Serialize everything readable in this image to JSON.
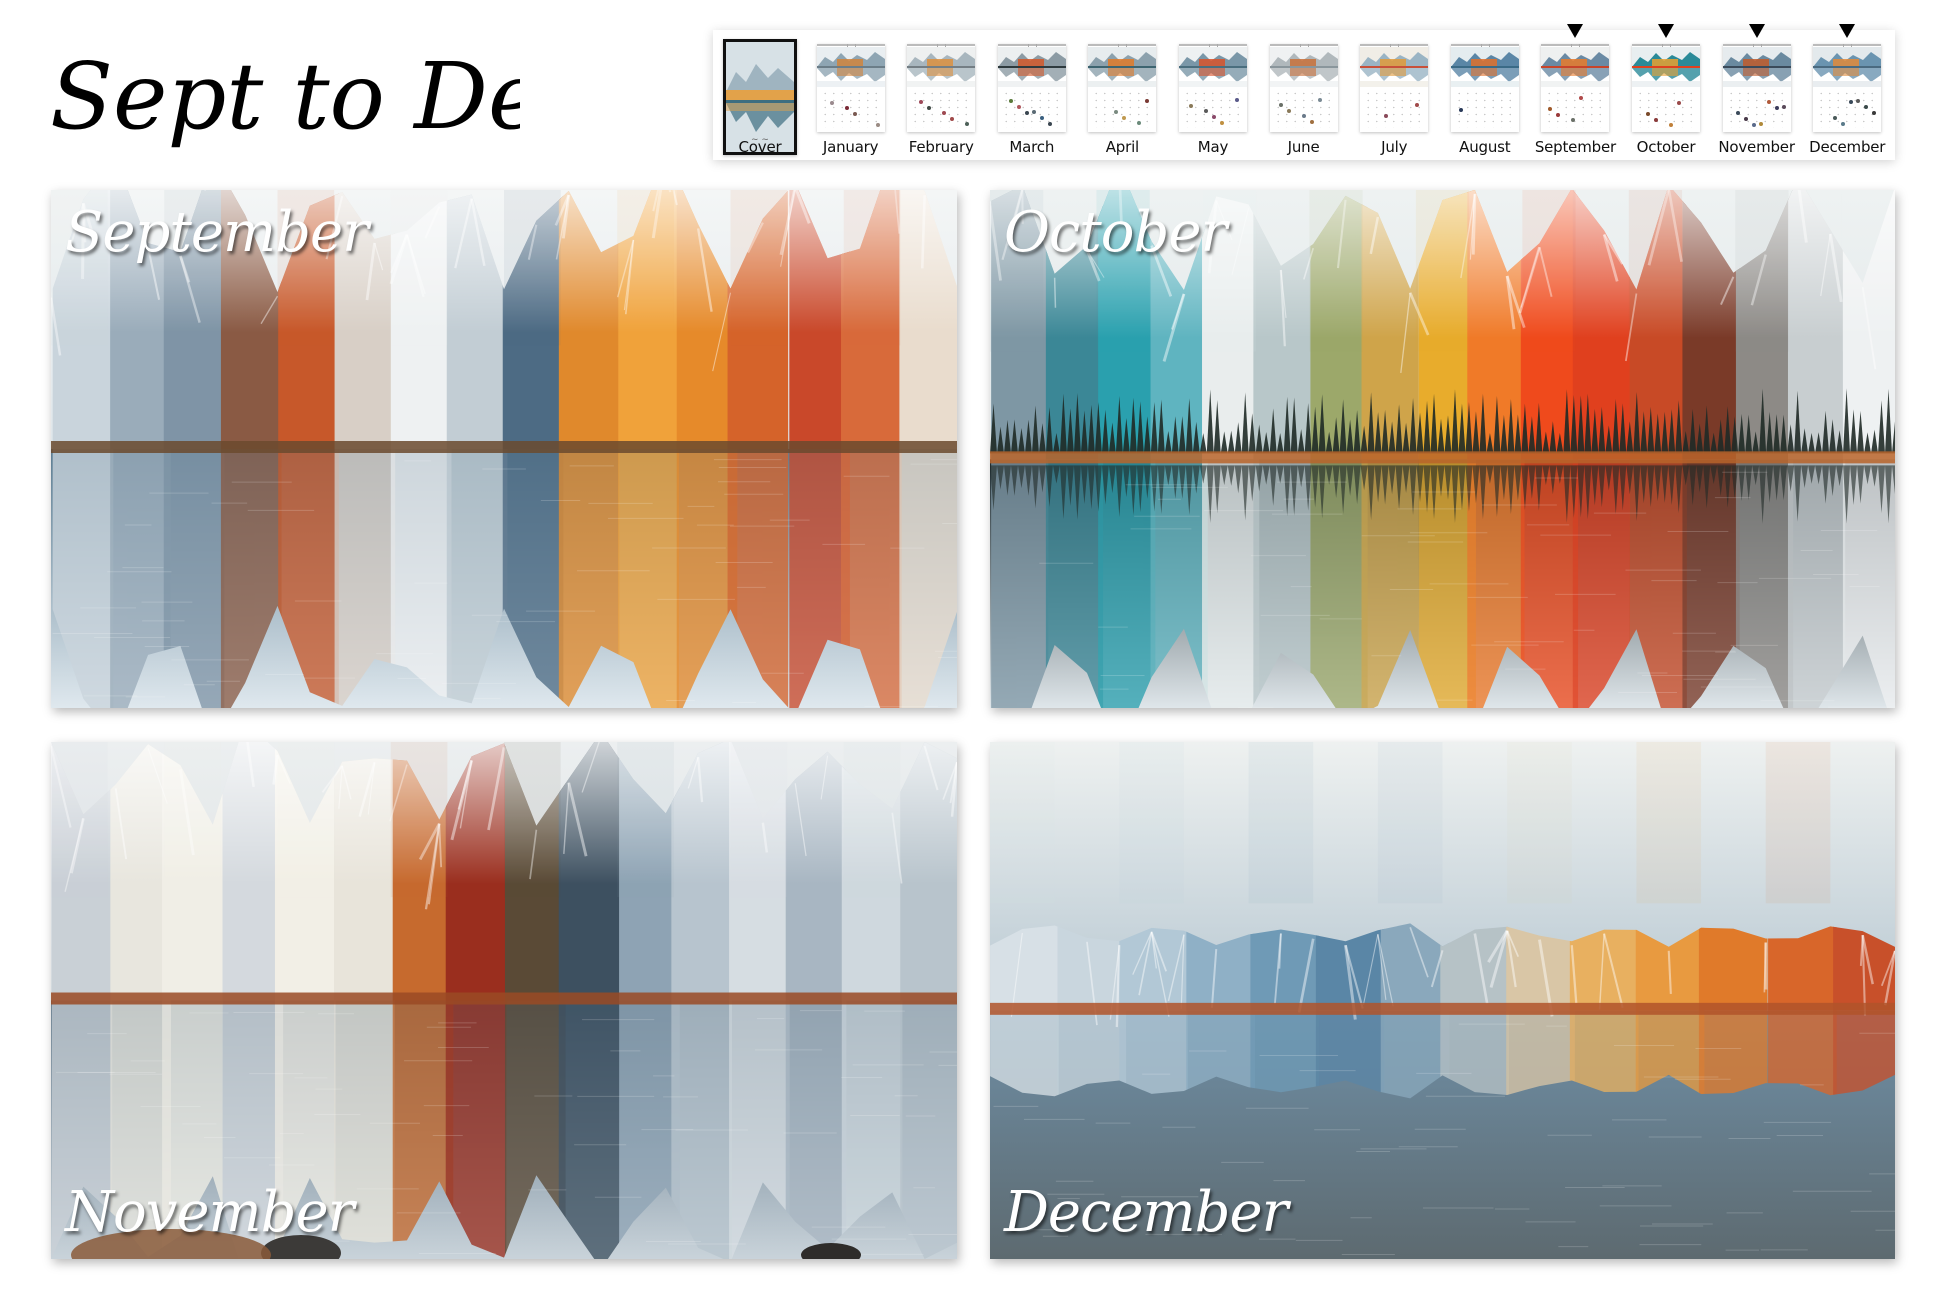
{
  "title": "Sept to Dec",
  "thumbnail_strip": {
    "items": [
      {
        "label": "Cover",
        "selected_frame": true,
        "marker": false,
        "palette": [
          "#d7e1e6",
          "#9fb4c0",
          "#e2a24a",
          "#3d6e80"
        ],
        "dots": []
      },
      {
        "label": "January",
        "selected_frame": false,
        "marker": false,
        "palette": [
          "#e9eef1",
          "#8ea5b3",
          "#d0843c",
          "#6b7d88"
        ],
        "dots": [
          "#9a8a8e",
          "#7a5a52",
          "#9a8b84",
          "#7a2a36"
        ]
      },
      {
        "label": "February",
        "selected_frame": false,
        "marker": false,
        "palette": [
          "#eef0f0",
          "#a8b6be",
          "#dc9040",
          "#747e84"
        ],
        "dots": [
          "#3f4a45",
          "#a04a4a",
          "#9e4a5a",
          "#9e4a52",
          "#4d6058"
        ]
      },
      {
        "label": "March",
        "selected_frame": false,
        "marker": false,
        "palette": [
          "#eceff0",
          "#8c9ba4",
          "#d2582a",
          "#2e3a3e"
        ],
        "dots": [
          "#3a4650",
          "#3a4650",
          "#b0585e",
          "#3a6080",
          "#5a7a3a",
          "#5a6a74"
        ]
      },
      {
        "label": "April",
        "selected_frame": false,
        "marker": false,
        "palette": [
          "#e7ecee",
          "#8ca1ad",
          "#e07a28",
          "#3d6470"
        ],
        "dots": [
          "#c09a50",
          "#7a3a34",
          "#7a8a80",
          "#6a8a7a"
        ]
      },
      {
        "label": "May",
        "selected_frame": false,
        "marker": false,
        "palette": [
          "#eef1f2",
          "#7a97a8",
          "#d8522a",
          "#4a6e7e"
        ],
        "dots": [
          "#c09040",
          "#8a7a5a",
          "#8a4a6a",
          "#5a5a8a",
          "#5a5a5a"
        ]
      },
      {
        "label": "June",
        "selected_frame": false,
        "marker": false,
        "palette": [
          "#eff1f2",
          "#b0b8bc",
          "#c8703a",
          "#8a969c"
        ],
        "dots": [
          "#7a8a94",
          "#8a7a5a",
          "#a07040",
          "#6a7068",
          "#6a7a8a"
        ]
      },
      {
        "label": "July",
        "selected_frame": false,
        "marker": false,
        "palette": [
          "#f0ede6",
          "#9ab4c4",
          "#e09a3a",
          "#c8503a"
        ],
        "dots": [
          "#a04a4a",
          "#8a4a5a"
        ]
      },
      {
        "label": "August",
        "selected_frame": false,
        "marker": false,
        "palette": [
          "#e4ecef",
          "#5a86a6",
          "#e0702a",
          "#3a6a86"
        ],
        "dots": [
          "#2a3a5a"
        ]
      },
      {
        "label": "September",
        "selected_frame": false,
        "marker": true,
        "palette": [
          "#eef0f0",
          "#6a8aa4",
          "#e87a2a",
          "#c8442a"
        ],
        "dots": [
          "#9a3a3a",
          "#b04a4a",
          "#a05a2a",
          "#6a7068"
        ]
      },
      {
        "label": "October",
        "selected_frame": false,
        "marker": true,
        "palette": [
          "#e8eef0",
          "#2a8a98",
          "#e8a030",
          "#e0401e"
        ],
        "dots": [
          "#8a3a3a",
          "#9a4a4a",
          "#7a4a2a",
          "#c0803a"
        ]
      },
      {
        "label": "November",
        "selected_frame": false,
        "marker": true,
        "palette": [
          "#e6ebee",
          "#6a8aa0",
          "#c05a2a",
          "#3a4a5a"
        ],
        "dots": [
          "#5a6a8a",
          "#3a3a5a",
          "#4a3a4a",
          "#b05a3a",
          "#3a4a5a",
          "#b08a3a",
          "#5a4a5a"
        ]
      },
      {
        "label": "December",
        "selected_frame": false,
        "marker": true,
        "palette": [
          "#e3e9ec",
          "#6a94b0",
          "#e08a3a",
          "#4a6a80"
        ],
        "dots": [
          "#3a4a5a",
          "#3a3a3a",
          "#5a7a8a",
          "#3a4a4a",
          "#4a5a5a",
          "#5a5a5a"
        ]
      }
    ]
  },
  "panels": [
    {
      "id": "september",
      "label": "September",
      "label_position": "top-left",
      "sky": [
        "#f4f6f6",
        "#dfe6ea"
      ],
      "water": [
        "#5c7d92",
        "#dfe8ee"
      ],
      "shore": "#6b4a2e",
      "strips": [
        "#c9d4dc",
        "#9aacba",
        "#7f94a6",
        "#8a5a44",
        "#c7582a",
        "#d8cfc6",
        "#eef1f2",
        "#c2cdd4",
        "#4d6b84",
        "#e0892c",
        "#f0a23a",
        "#e68a2a",
        "#d5632a",
        "#c9482a",
        "#d86a3a",
        "#e9dccd"
      ]
    },
    {
      "id": "october",
      "label": "October",
      "label_position": "top-left",
      "sky": [
        "#eef2f2",
        "#dfe6e8"
      ],
      "water": [
        "#1b2a30",
        "#dfe6ea"
      ],
      "shore": "#b8642a",
      "strips": [
        "#7e97a4",
        "#3b8796",
        "#2aa0ae",
        "#5fb4c0",
        "#e9eded",
        "#b8c7c9",
        "#9ca86a",
        "#cfa44a",
        "#e8ac2c",
        "#f07a28",
        "#ef4a1c",
        "#e0401e",
        "#c84a26",
        "#7a3a28",
        "#8d8a86",
        "#c8ced0",
        "#eef1f2"
      ]
    },
    {
      "id": "november",
      "label": "November",
      "label_position": "bottom-left",
      "sky": [
        "#eceff0",
        "#d8dfe3"
      ],
      "water": [
        "#4a6478",
        "#c9d3da"
      ],
      "shore": "#9a4a24",
      "strips": [
        "#c9d0d6",
        "#e8e6de",
        "#f0eee6",
        "#d4d9de",
        "#f2efe6",
        "#e8e4da",
        "#c66a2e",
        "#9a2e1e",
        "#5a4a36",
        "#3d5060",
        "#8ea3b4",
        "#b7c4ce",
        "#d6dde2",
        "#a8b6c2",
        "#cfd8de",
        "#b8c4cc"
      ]
    },
    {
      "id": "december",
      "label": "December",
      "label_position": "bottom-left",
      "sky": [
        "#eef1f0",
        "#b8c8d2"
      ],
      "water": [
        "#6f8fa6",
        "#5d6a70"
      ],
      "shore": "#b0532a",
      "strips": [
        "#d7e0e6",
        "#c9d6de",
        "#b2c8d6",
        "#8fb0c6",
        "#6f9ab6",
        "#5a86a6",
        "#8aa8bc",
        "#b6c2c6",
        "#d9c6a6",
        "#e8b060",
        "#e89a40",
        "#e07a2a",
        "#d8662a",
        "#c8502a"
      ]
    }
  ]
}
